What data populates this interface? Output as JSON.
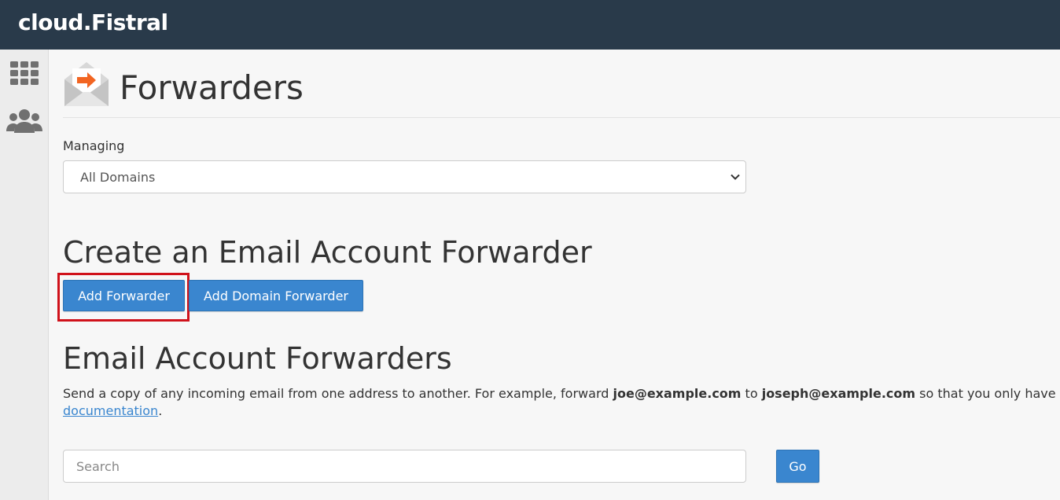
{
  "header": {
    "brand": "cloud.Fistral"
  },
  "sidebar": {
    "items": [
      {
        "icon": "grid-icon"
      },
      {
        "icon": "users-icon"
      }
    ]
  },
  "page": {
    "title": "Forwarders",
    "icon": "forward-mail-icon"
  },
  "managing": {
    "label": "Managing",
    "selected": "All Domains"
  },
  "create_section": {
    "heading": "Create an Email Account Forwarder",
    "add_forwarder_label": "Add Forwarder",
    "add_domain_forwarder_label": "Add Domain Forwarder"
  },
  "forwarders_section": {
    "heading": "Email Account Forwarders",
    "description_part1": "Send a copy of any incoming email from one address to another. For example, forward ",
    "example_from": "joe@example.com",
    "description_part2": " to ",
    "example_to": "joseph@example.com",
    "description_part3": " so that you only have",
    "doc_link": "documentation",
    "period": "."
  },
  "search": {
    "placeholder": "Search",
    "go_label": "Go"
  },
  "colors": {
    "topbar": "#293a4a",
    "button": "#3a86cf",
    "highlight": "#d0121b",
    "icon_accent": "#f26522"
  }
}
